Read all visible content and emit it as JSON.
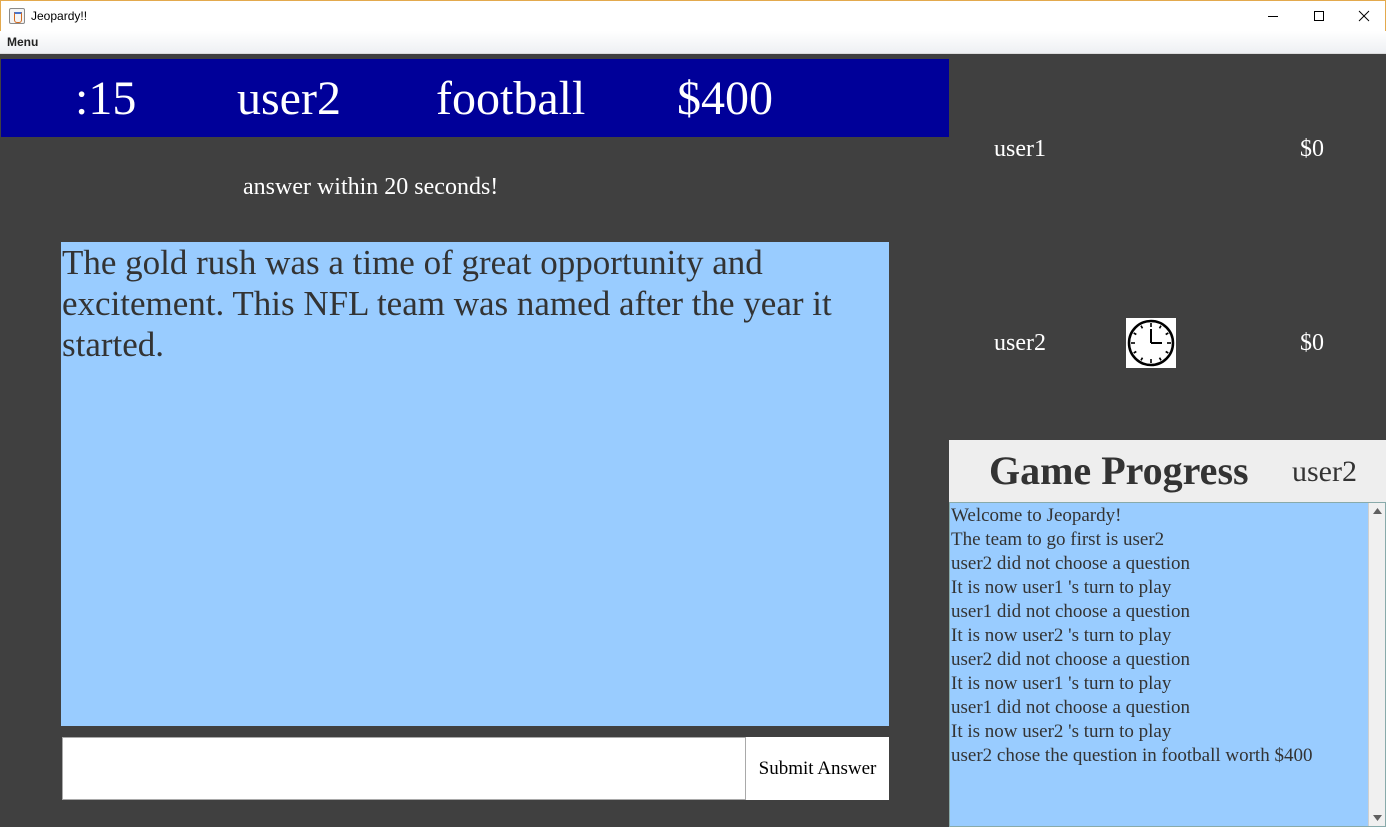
{
  "window": {
    "title": "Jeopardy!!",
    "menu_label": "Menu"
  },
  "header": {
    "timer": ":15",
    "current_user": "user2",
    "category": "football",
    "value": "$400"
  },
  "instruction": "answer within 20 seconds!",
  "question": "The gold rush was a time of great opportunity and excitement. This NFL team was named after the year it started.",
  "answer": {
    "value": "",
    "submit_label": "Submit Answer"
  },
  "players": [
    {
      "name": "user1",
      "score": "$0",
      "active": false
    },
    {
      "name": "user2",
      "score": "$0",
      "active": true
    }
  ],
  "progress": {
    "title": "Game Progress",
    "current_user": "user2",
    "log": [
      "Welcome to Jeopardy!",
      "The team to go first is user2",
      "user2 did not choose a question",
      "It is now user1 's turn to play",
      "user1 did not choose a question",
      "It is now user2 's turn to play",
      "user2 did not choose a question",
      "It is now user1 's turn to play",
      "user1 did not choose a question",
      "It is now user2 's turn to play",
      "user2 chose the question in football worth $400"
    ]
  },
  "icons": {
    "app": "java-cup-icon",
    "active_player": "clock-icon"
  },
  "colors": {
    "header_band": "#000099",
    "background": "#404040",
    "question_box": "#99ccff",
    "log_panel": "#99ccff"
  }
}
